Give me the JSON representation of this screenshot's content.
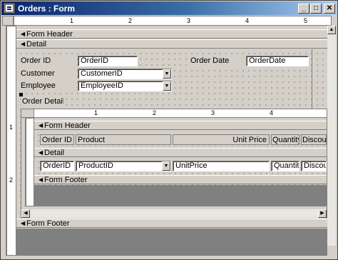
{
  "window": {
    "title": "Orders : Form"
  },
  "titlebar_buttons": {
    "minimize": "_",
    "maximize": "□",
    "close": "✕"
  },
  "ruler_main": [
    "1",
    "2",
    "3",
    "4",
    "5"
  ],
  "ruler_vertical": [
    "1",
    "2"
  ],
  "form": {
    "header_label": "Form Header",
    "detail_label": "Detail",
    "footer_label": "Form Footer",
    "labels": {
      "order_id": "Order ID",
      "customer": "Customer",
      "employee": "Employee",
      "order_date": "Order Date",
      "order_details": "Order Details"
    },
    "fields": {
      "order_id": "OrderID",
      "customer": "CustomerID",
      "employee": "EmployeeID",
      "order_date": "OrderDate"
    }
  },
  "subform": {
    "ruler": [
      "1",
      "2",
      "3",
      "4"
    ],
    "header_label": "Form Header",
    "detail_label": "Detail",
    "footer_label": "Form Footer",
    "column_labels": {
      "order_id": "Order ID",
      "product": "Product",
      "unit_price": "Unit Price",
      "quantity": "Quantity",
      "discount": "Discount"
    },
    "fields": {
      "order_id": "OrderID",
      "product": "ProductID",
      "unit_price": "UnitPrice",
      "quantity": "Quantity",
      "discount": "Discount"
    }
  }
}
